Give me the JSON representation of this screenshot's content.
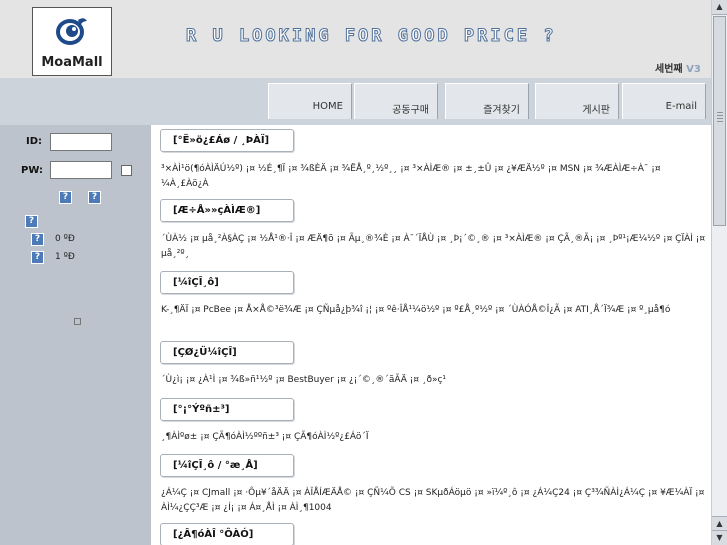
{
  "header": {
    "logo_text": "MoaMall",
    "slogan": "R U LOOKING FOR GOOD PRICE ?",
    "version_label": "세번째",
    "version_suffix": "V3"
  },
  "nav": {
    "tabs": [
      "HOME",
      "공동구매",
      "즐겨찾기",
      "게시판",
      "E-mail"
    ]
  },
  "login": {
    "id_label": "ID:",
    "pw_label": "PW:",
    "help_glyph": "?",
    "count_a": "0 ºÐ",
    "count_b": "1 ºÐ"
  },
  "sections": [
    {
      "title": "[°Ë»ö¿£Áø / ¸ÞÀÏ]",
      "body": "³×ÀÌ¹ö(¶óÀÌÄÚ½º) ¡¤ ½É¸¶Ï ¡¤ ¾ßÈÄ ¡¤ ¾ËÅ¸º¸½º¸¸ ¡¤ ³×ÀÌÆ® ¡¤ ±¸±Û ¡¤ ¿¥ÆÄ½º ¡¤ MSN ¡¤ ¾ÆÀÌÆ÷À¯ ¡¤ ¼À¸£Àö¿À"
    },
    {
      "title": "[Æ÷Å»»çÀÌÆ®]",
      "body": "´ÙÀ½ ¡¤ µå¸²À§ÀÇ ¡¤ ½Å¹®·Î ¡¤ ÆÄ¶õ ¡¤ Ãµ¸®¾È ¡¤ À¯´ÏÅÙ ¡¤ ¸Þ¡´©¸® ¡¤ ³×ÀÌÆ® ¡¤ ÇÃ¸®Ã¡ ¡¤ ¸Þº¹¡Æ¼½º ¡¤ ÇÏÀÌ ¡¤ µå¸²º¸"
    },
    {
      "title": "[¼îÇÎ¸ô]",
      "body": "K-¸¶ÄÏ ¡¤ PcBee ¡¤ Å×Å©³ë¾Æ ¡¤ ÇÑµå¿þ¾î ¡¦ ¡¤ ºê·ÎÅ¹¼ö½º ¡¤ º£Å¸º½º ¡¤ ´ÙÀÓÅ©Î¿Ã ¡¤ ATI¸Å´Ï¾Æ ¡¤ º¸µå¶ó"
    },
    {
      "title": "[ÇØ¿Ü¼îÇÎ]",
      "body": "´Ù¿ì¡ ¡¤ ¿À¹Ì ¡¤ ¾ß»ñ¹½º ¡¤ BestBuyer ¡¤ ¿¡´©¸®´ãÃÄ ¡¤ ¸ð»ç¹"
    },
    {
      "title": "[°¡°Ýºñ±³]",
      "body": "¸¶ÀÌºø± ¡¤ ÇÃ¶óÀÌ½ººñ±³ ¡¤ ÇÃ¶óÀÌ½º¿£Áö´Ï"
    },
    {
      "title": "[¼îÇÎ¸ô / °æ¸Å]",
      "body": "¿Á¼Ç ¡¤ CJmall ¡¤ ·Ôµ¥´åÄÄ ¡¤ ÀÎÅÍÆÄÅ© ¡¤ ÇÑ¼Õ CS ¡¤ SKµðÁöµö ¡¤ »ï¼º¸ô ¡¤ ¿Á¼Ç24 ¡¤ Ç³¾ÑÀÌ¿Á¼Ç ¡¤ ¥Æ¼ÀÏ ¡¤ ÀÌ¼¿ÇÇ³Æ ¡¤ ¿Í¡ ¡¤ Á¤¸ÅÌ ¡¤ ÀÌ¸¶1004"
    },
    {
      "title": "[¿Â¶óÀÎ °ÔÀÓ]",
      "body": ""
    }
  ],
  "scrollbar": {
    "up_glyph": "▲",
    "down_glyph": "▼"
  }
}
